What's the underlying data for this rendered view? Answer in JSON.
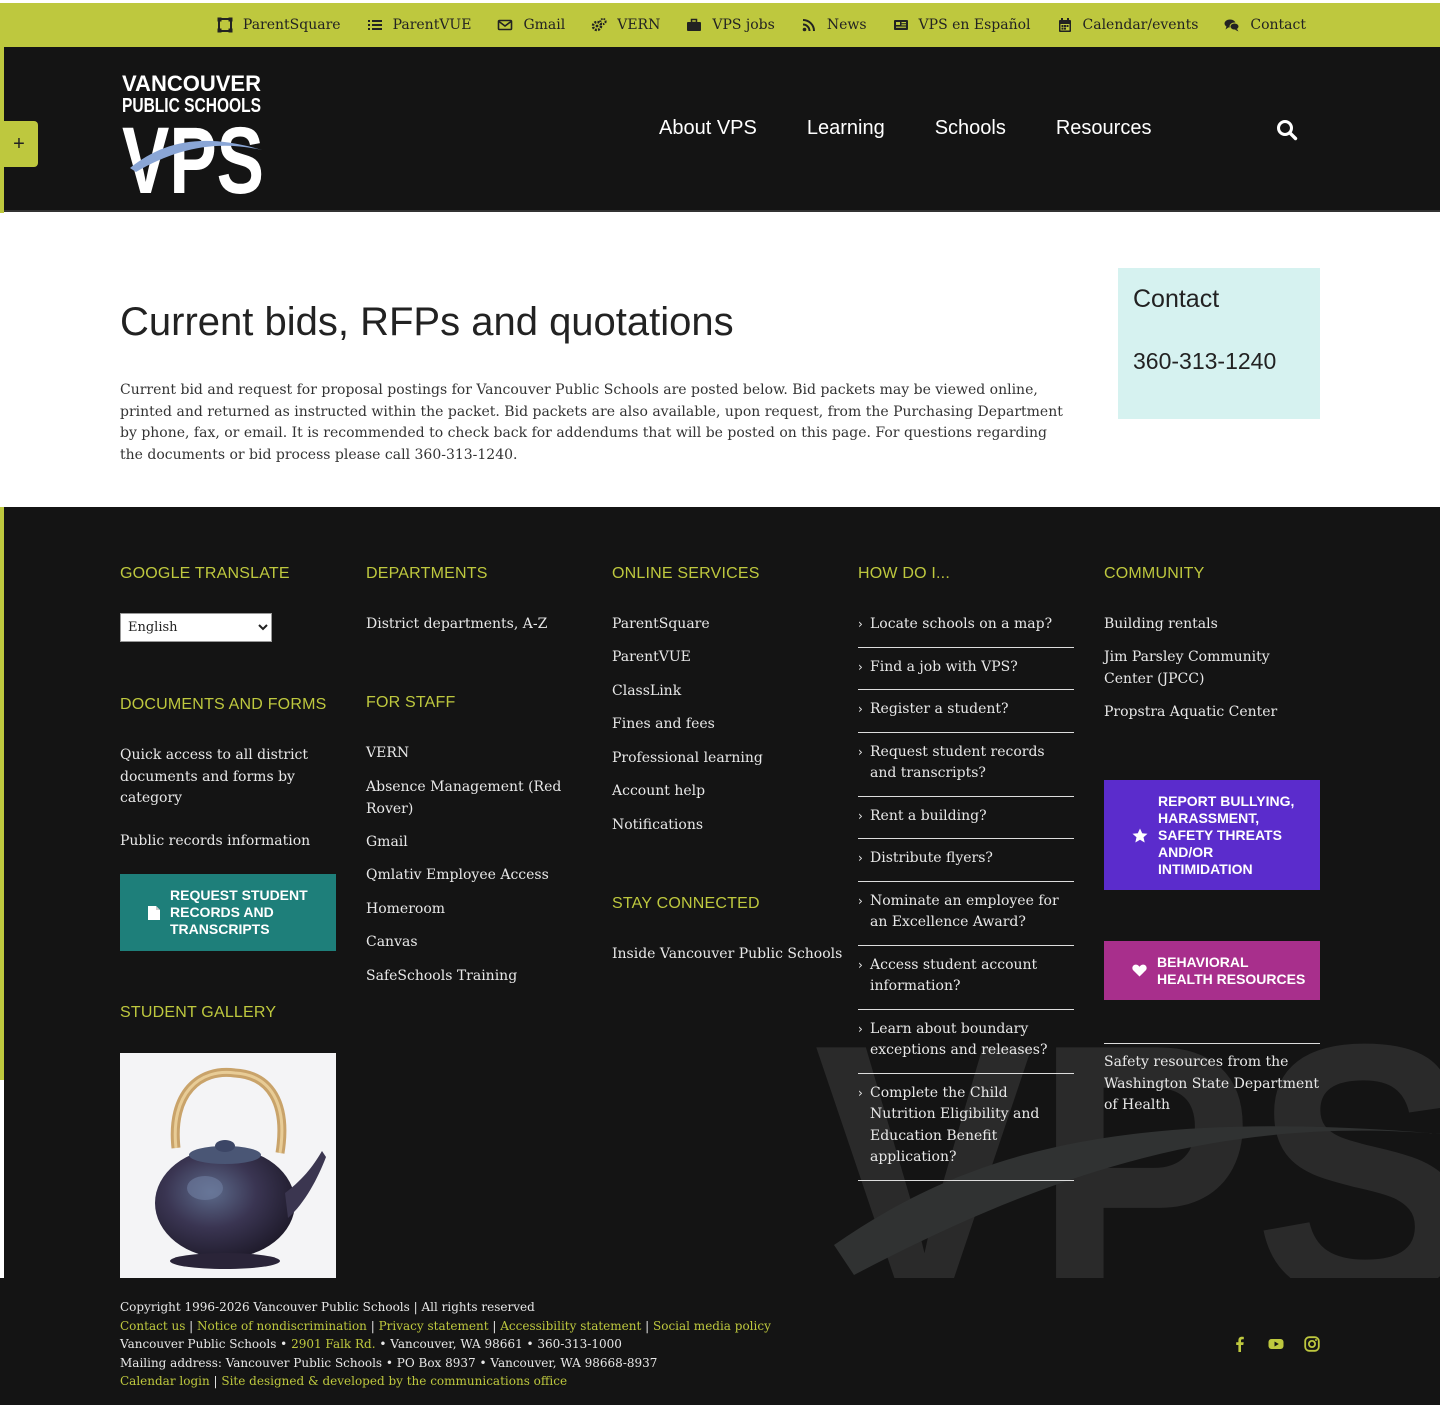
{
  "utility_nav": [
    {
      "label": "ParentSquare",
      "icon": "parentsquare-icon"
    },
    {
      "label": "ParentVUE",
      "icon": "list-icon"
    },
    {
      "label": "Gmail",
      "icon": "envelope-icon"
    },
    {
      "label": "VERN",
      "icon": "gears-icon"
    },
    {
      "label": "VPS jobs",
      "icon": "briefcase-icon"
    },
    {
      "label": "News",
      "icon": "rss-icon"
    },
    {
      "label": "VPS en Español",
      "icon": "newspaper-icon"
    },
    {
      "label": "Calendar/events",
      "icon": "calendar-icon"
    },
    {
      "label": "Contact",
      "icon": "comments-icon"
    }
  ],
  "header": {
    "logo_line1": "VANCOUVER",
    "logo_line2": "PUBLIC SCHOOLS",
    "logo_mark": "VPS",
    "nav": [
      "About VPS",
      "Learning",
      "Schools",
      "Resources"
    ],
    "sidebar_toggle": "+"
  },
  "main": {
    "title": "Current bids, RFPs and quotations",
    "intro": "Current bid and request for proposal postings for Vancouver Public Schools are posted below. Bid packets may be viewed online, printed and returned as instructed within the packet. Bid packets are also available, upon request, from the Purchasing Department by phone, fax, or email. It is recommended to check back for addendums that will be posted on this page. For questions regarding the documents or bid process please call 360-313-1240.",
    "contact_title": "Contact",
    "contact_phone": "360-313-1240"
  },
  "footer": {
    "google_translate": {
      "heading": "GOOGLE TRANSLATE",
      "selected": "English"
    },
    "documents": {
      "heading": "DOCUMENTS AND FORMS",
      "items": [
        "Quick access to all district documents and forms by category",
        "Public records information"
      ]
    },
    "request_button": "REQUEST STUDENT RECORDS AND TRANSCRIPTS",
    "gallery_heading": "STUDENT GALLERY",
    "departments": {
      "heading": "DEPARTMENTS",
      "items": [
        "District departments, A-Z"
      ]
    },
    "for_staff": {
      "heading": "FOR STAFF",
      "items": [
        "VERN",
        "Absence Management (Red Rover)",
        "Gmail",
        "Qmlativ Employee Access",
        "Homeroom",
        "Canvas",
        "SafeSchools Training"
      ]
    },
    "online_services": {
      "heading": "ONLINE SERVICES",
      "items": [
        "ParentSquare",
        "ParentVUE",
        "ClassLink",
        "Fines and fees",
        "Professional learning",
        "Account help",
        "Notifications"
      ]
    },
    "stay_connected": {
      "heading": "STAY CONNECTED",
      "items": [
        "Inside Vancouver Public Schools"
      ]
    },
    "how_do_i": {
      "heading": "HOW DO I...",
      "items": [
        "Locate schools on a map?",
        "Find a job with VPS?",
        "Register a student?",
        "Request student records and transcripts?",
        "Rent a building?",
        "Distribute flyers?",
        "Nominate an employee for an Excellence Award?",
        "Access student account information?",
        "Learn about boundary exceptions and releases?",
        "Complete the Child Nutrition Eligibility and Education Benefit application?"
      ]
    },
    "community": {
      "heading": "COMMUNITY",
      "items": [
        "Building rentals",
        "Jim Parsley Community Center (JPCC)",
        "Propstra Aquatic Center"
      ]
    },
    "report_button": "REPORT BULLYING, HARASSMENT, SAFETY THREATS AND/OR INTIMIDATION",
    "behavioral_button": "BEHAVIORAL HEALTH RESOURCES",
    "safety_text": "Safety resources from the Washington State Department of Health"
  },
  "bottom": {
    "copyright": "Copyright 1996-2026 Vancouver Public Schools | All rights reserved",
    "links": [
      "Contact us",
      "Notice of nondiscrimination",
      "Privacy statement",
      "Accessibility statement",
      "Social media policy"
    ],
    "address_prefix": "Vancouver Public Schools • ",
    "address_link": "2901 Falk Rd.",
    "address_suffix": " • Vancouver, WA 98661 • 360-313-1000",
    "mailing": "Mailing address: Vancouver Public Schools • PO Box 8937 • Vancouver, WA 98668-8937",
    "calendar_login": "Calendar login",
    "designed_by": "Site designed & developed by the communications office",
    "social": [
      "facebook-icon",
      "youtube-icon",
      "instagram-icon"
    ]
  },
  "colors": {
    "accent": "#bec83e",
    "dark": "#141414",
    "teal": "#1e7f7a",
    "purple": "#5b2ccc",
    "magenta": "#a82f8c",
    "contact_bg": "#d6f2f0"
  }
}
